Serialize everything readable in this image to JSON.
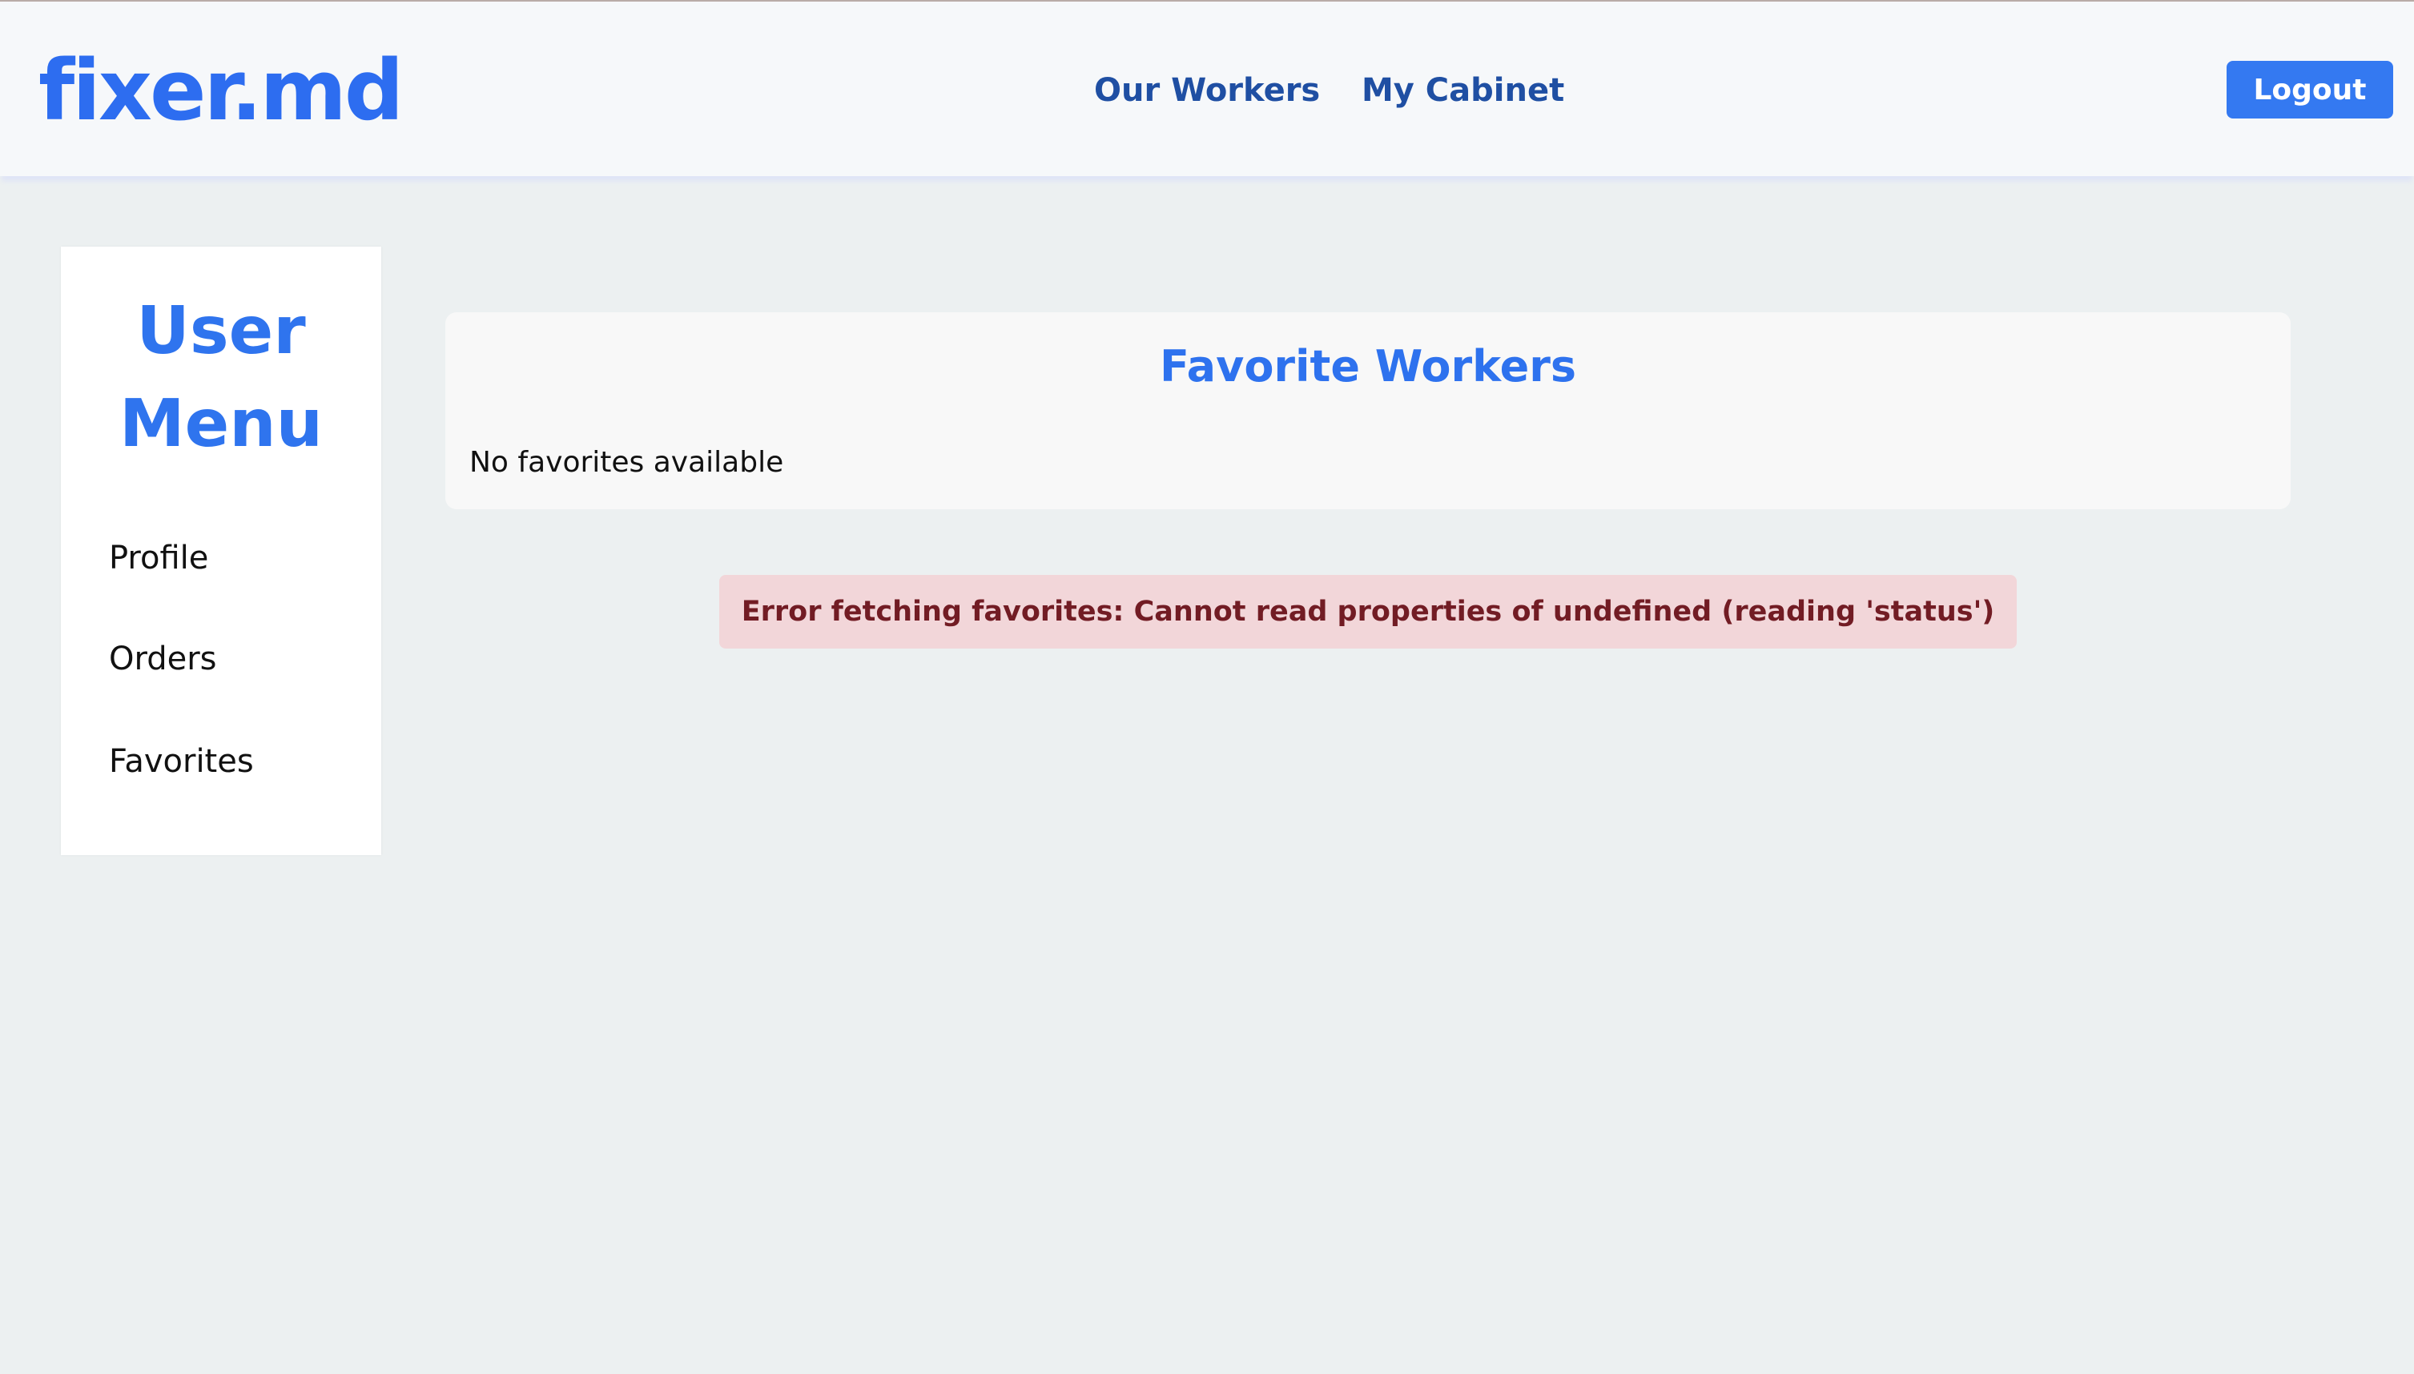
{
  "header": {
    "logo": "fixer.md",
    "nav": {
      "our_workers": "Our Workers",
      "my_cabinet": "My Cabinet"
    },
    "logout_label": "Logout"
  },
  "sidebar": {
    "title": "User Menu",
    "items": [
      {
        "label": "Profile"
      },
      {
        "label": "Orders"
      },
      {
        "label": "Favorites"
      }
    ]
  },
  "main": {
    "favorites_title": "Favorite Workers",
    "empty_message": "No favorites available",
    "error_message": "Error fetching favorites: Cannot read properties of undefined (reading 'status')"
  },
  "colors": {
    "brand_blue": "#2d6df0",
    "nav_blue": "#1f4fa3",
    "button_blue": "#3479f1",
    "error_bg": "#f2d6d9",
    "error_text": "#721c24",
    "page_bg": "#ecf0f1"
  }
}
